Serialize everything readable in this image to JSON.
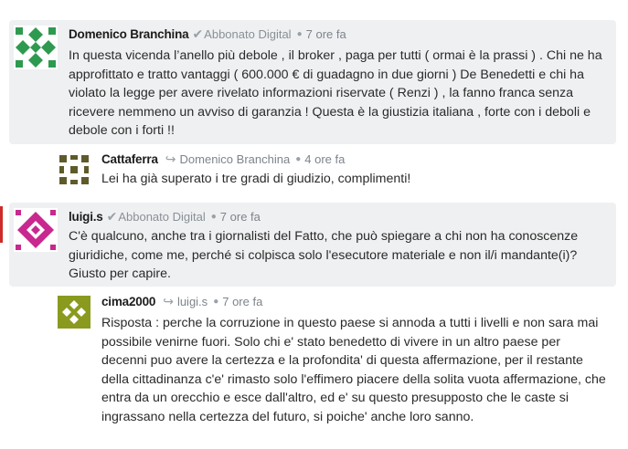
{
  "comments": [
    {
      "author": "Domenico Branchina",
      "badge": "Abbonato Digital",
      "time": "7 ore fa",
      "text": "In questa vicenda l’anello più debole , il broker , paga per tutti ( ormai è la prassi ) . Chi ne ha approfittato e tratto vantaggi ( 600.000 € di guadagno in due giorni ) De Benedetti e chi ha violato la legge per avere rivelato informazioni riservate ( Renzi ) , la fanno franca senza ricevere nemmeno un avviso di garanzia ! Questa è la giustizia italiana , forte con i deboli e debole con i forti !!",
      "avatar_color": "#2e9a4f"
    },
    {
      "author": "Cattaferra",
      "reply_to": "Domenico Branchina",
      "time": "4 ore fa",
      "text": "Lei ha già superato i tre gradi di giudizio, complimenti!",
      "avatar_color": "#5e5b2b"
    },
    {
      "author": "luigi.s",
      "badge": "Abbonato Digital",
      "time": "7 ore fa",
      "text": "C'è qualcuno, anche tra i giornalisti del Fatto, che può spiegare a chi non ha conoscenze giuridiche, come me, perché si colpisca solo l'esecutore materiale e non il/i mandante(i)? Giusto per capire.",
      "avatar_color": "#c8288f"
    },
    {
      "author": "cima2000",
      "reply_to": "luigi.s",
      "time": "7 ore fa",
      "text": "Risposta : perche la corruzione in questo paese si annoda a tutti i livelli e non sara mai possibile venirne fuori. Solo chi e' stato benedetto di vivere in un altro paese per decenni puo avere la certezza e la profondita' di questa affermazione, per il restante della cittadinanza c'e' rimasto solo l'effimero piacere della solita vuota affermazione, che entra da un orecchio e esce dall'altro, ed e' su questo presupposto che le caste si ingrassano nella certezza del futuro, si poiche' anche loro sanno.",
      "avatar_color": "#8a9a1f"
    }
  ],
  "icons": {
    "verified": "check-icon",
    "reply": "reply-arrow-icon"
  }
}
